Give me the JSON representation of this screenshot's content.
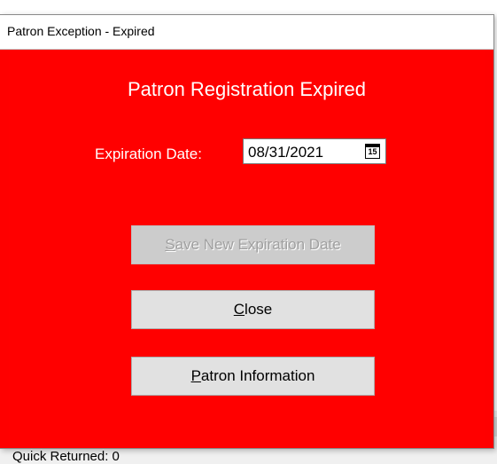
{
  "window": {
    "title": "Patron Exception - Expired"
  },
  "dialog": {
    "heading": "Patron Registration Expired",
    "expiration_label": "Expiration Date:",
    "expiration_value": "08/31/2021",
    "calendar_icon": "calendar-icon",
    "calendar_day": "15"
  },
  "buttons": {
    "save": {
      "mnemonic": "S",
      "rest": "ave New Expiration Date",
      "enabled": false
    },
    "close": {
      "mnemonic": "C",
      "rest": "lose",
      "enabled": true
    },
    "patron_info": {
      "mnemonic": "P",
      "rest": "atron Information",
      "enabled": true
    }
  },
  "background": {
    "partial_text": "Quick Returned: 0"
  },
  "colors": {
    "dialog_background": "#ff0000",
    "button_face": "#e1e1e1",
    "disabled_text": "#a0a0a0"
  }
}
